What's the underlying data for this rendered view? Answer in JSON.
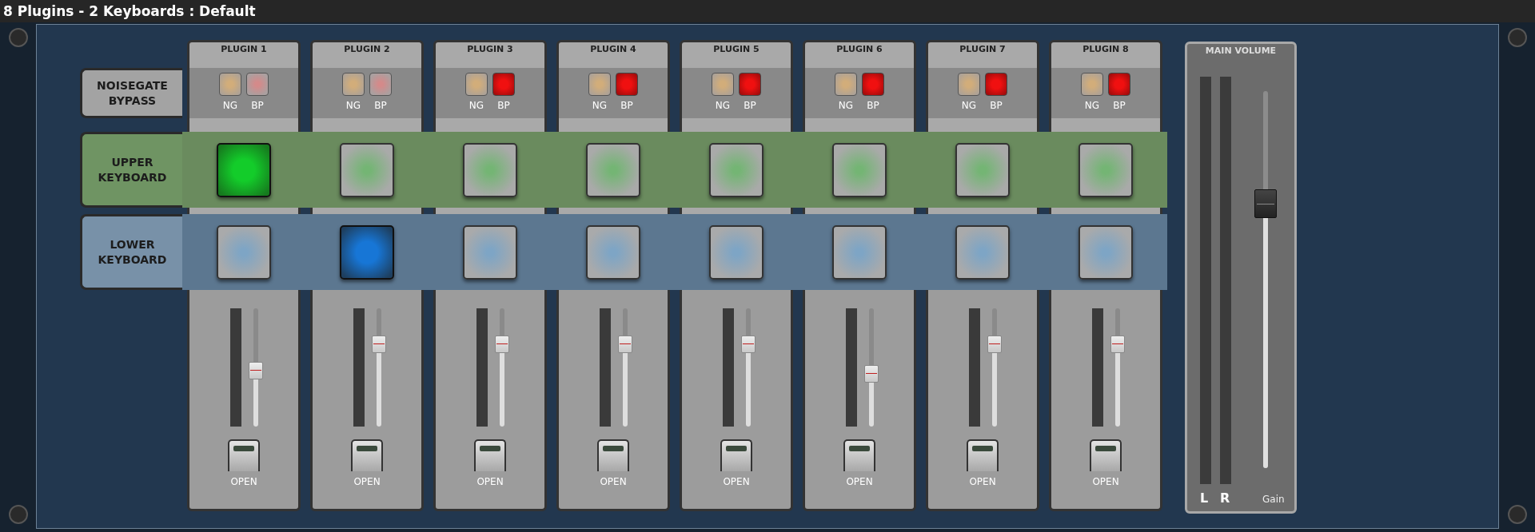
{
  "window": {
    "title": "8 Plugins - 2 Keyboards : Default"
  },
  "row_labels": [
    {
      "kind": "bypass",
      "text": "NOISEGATE BYPASS"
    },
    {
      "kind": "upper",
      "text": "UPPER KEYBOARD"
    },
    {
      "kind": "lower",
      "text": "LOWER KEYBOARD"
    }
  ],
  "plugins": [
    {
      "name": "PLUGIN 1",
      "ng": {
        "label": "NG",
        "on": false
      },
      "bp": {
        "label": "BP",
        "on": false
      },
      "upper": {
        "selected": true
      },
      "lower": {
        "selected": false
      },
      "fader": {
        "level": 0.51
      },
      "open": "OPEN"
    },
    {
      "name": "PLUGIN 2",
      "ng": {
        "label": "NG",
        "on": false
      },
      "bp": {
        "label": "BP",
        "on": false
      },
      "upper": {
        "selected": false
      },
      "lower": {
        "selected": true
      },
      "fader": {
        "level": 0.73
      },
      "open": "OPEN"
    },
    {
      "name": "PLUGIN 3",
      "ng": {
        "label": "NG",
        "on": false
      },
      "bp": {
        "label": "BP",
        "on": true
      },
      "upper": {
        "selected": false
      },
      "lower": {
        "selected": false
      },
      "fader": {
        "level": 0.73
      },
      "open": "OPEN"
    },
    {
      "name": "PLUGIN 4",
      "ng": {
        "label": "NG",
        "on": false
      },
      "bp": {
        "label": "BP",
        "on": true
      },
      "upper": {
        "selected": false
      },
      "lower": {
        "selected": false
      },
      "fader": {
        "level": 0.73
      },
      "open": "OPEN"
    },
    {
      "name": "PLUGIN 5",
      "ng": {
        "label": "NG",
        "on": false
      },
      "bp": {
        "label": "BP",
        "on": true
      },
      "upper": {
        "selected": false
      },
      "lower": {
        "selected": false
      },
      "fader": {
        "level": 0.73
      },
      "open": "OPEN"
    },
    {
      "name": "PLUGIN 6",
      "ng": {
        "label": "NG",
        "on": false
      },
      "bp": {
        "label": "BP",
        "on": true
      },
      "upper": {
        "selected": false
      },
      "lower": {
        "selected": false
      },
      "fader": {
        "level": 0.48
      },
      "open": "OPEN"
    },
    {
      "name": "PLUGIN 7",
      "ng": {
        "label": "NG",
        "on": false
      },
      "bp": {
        "label": "BP",
        "on": true
      },
      "upper": {
        "selected": false
      },
      "lower": {
        "selected": false
      },
      "fader": {
        "level": 0.73
      },
      "open": "OPEN"
    },
    {
      "name": "PLUGIN 8",
      "ng": {
        "label": "NG",
        "on": false
      },
      "bp": {
        "label": "BP",
        "on": true
      },
      "upper": {
        "selected": false
      },
      "lower": {
        "selected": false
      },
      "fader": {
        "level": 0.73
      },
      "open": "OPEN"
    }
  ],
  "main_volume": {
    "title": "MAIN VOLUME",
    "left_label": "L",
    "right_label": "R",
    "gain_label": "Gain",
    "level": 0.71
  }
}
